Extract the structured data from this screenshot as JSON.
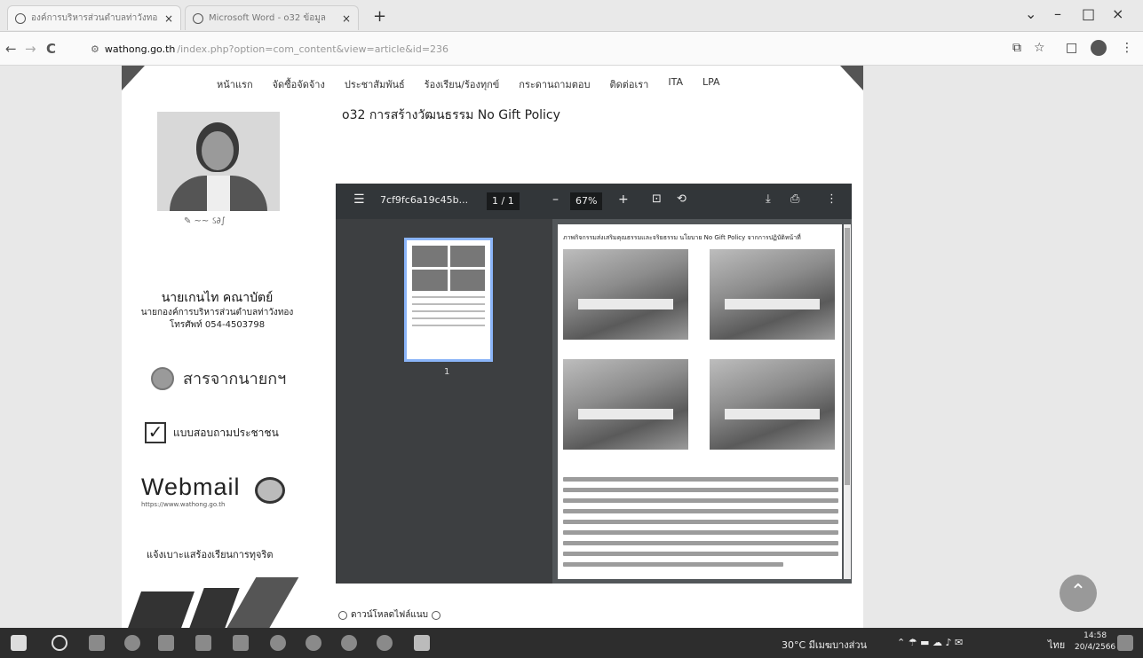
{
  "browser": {
    "tabs": [
      {
        "title": "องค์การบริหารส่วนตำบลท่าวังทอง",
        "close": "×"
      },
      {
        "title": "Microsoft Word - o32 ข้อมูล",
        "close": "×"
      }
    ],
    "new_tab": "+",
    "window": {
      "minimize": "–",
      "restore": "□",
      "close": "×"
    },
    "nav": {
      "back": "←",
      "forward": "→",
      "reload": "C"
    },
    "url_host": "wathong.go.th",
    "url_path": "/index.php?option=com_content&view=article&id=236",
    "toolbar_icons": [
      "cast-icon",
      "star-icon",
      "sidebar-icon",
      "profile-icon",
      "menu-icon"
    ]
  },
  "site": {
    "nav": [
      "หน้าแรก",
      "จัดซื้อจัดจ้าง",
      "ประชาสัมพันธ์",
      "ร้องเรียน/ร้องทุกข์",
      "กระดานถามตอบ",
      "ติดต่อเรา",
      "ITA",
      "LPA"
    ],
    "page_heading": "o32 การสร้างวัฒนธรรม No Gift Policy",
    "person": {
      "name": "นายเกนไท คณาบัตย์",
      "role": "นายกองค์การบริหารส่วนตำบลท่าวังทอง",
      "phone": "โทรศัพท์ 054-4503798"
    },
    "sidebar": {
      "message_link": "สารจากนายกฯ",
      "survey_link": "แบบสอบถามประชาชน",
      "webmail_title": "Webmail",
      "webmail_url": "https://www.wathong.go.th",
      "report_link": "แจ้งเบาะแสร้องเรียนการทุจริต"
    },
    "download_link": "ดาวน์โหลดไฟล์แนบ"
  },
  "pdf_viewer": {
    "filename": "7cf9fc6a19c45b...",
    "page_current": "1",
    "page_sep": "/",
    "page_total": "1",
    "zoom": "67%",
    "zoom_out": "–",
    "zoom_in": "+",
    "thumbnail_label": "1",
    "page_caption": "ภาพกิจกรรมส่งเสริมคุณธรรมและจริยธรรม นโยบาย No Gift Policy จากการปฏิบัติหน้าที่"
  },
  "taskbar": {
    "weather": "30°C มีเมฆบางส่วน",
    "lang": "ไทย",
    "time": "14:58",
    "date": "20/4/2566"
  }
}
